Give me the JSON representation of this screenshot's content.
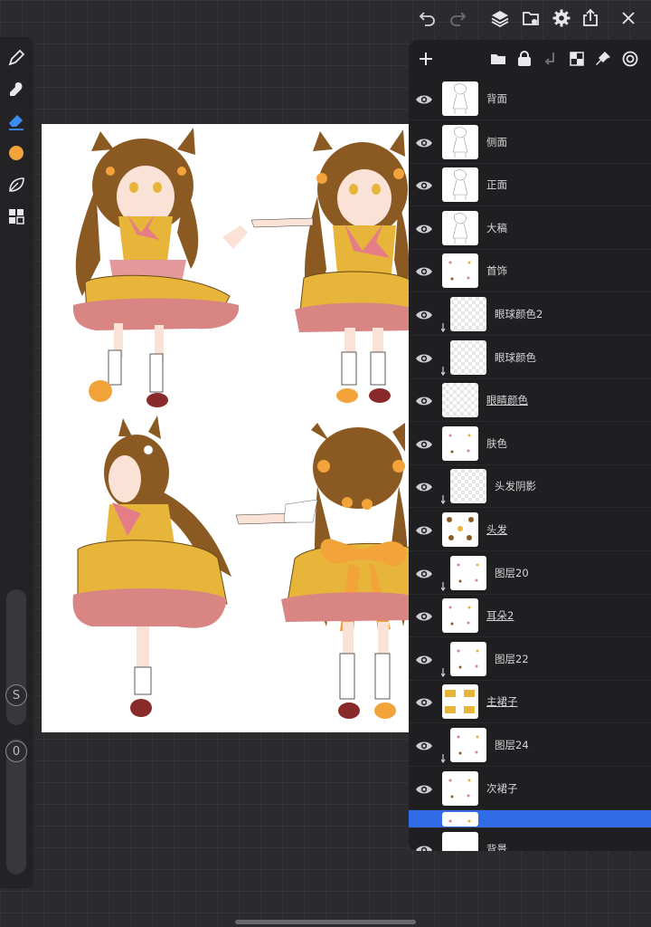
{
  "toolbar": {
    "icons": [
      "undo-icon",
      "redo-icon",
      "layers-icon",
      "gallery-icon",
      "settings-icon",
      "share-icon",
      "close-icon"
    ]
  },
  "left_tools": {
    "icons": [
      "brush-icon",
      "smudge-icon",
      "eraser-icon",
      "color-swatch",
      "leaf-icon",
      "layout-icon"
    ],
    "color": "#f2a33a",
    "size_slider_label": "S",
    "opacity_slider_label": "0"
  },
  "layers": [
    {
      "name": "背面",
      "thumb": "sketch",
      "clipped": false
    },
    {
      "name": "侧面",
      "thumb": "sketch",
      "clipped": false
    },
    {
      "name": "正面",
      "thumb": "sketch",
      "clipped": false
    },
    {
      "name": "大稿",
      "thumb": "sketch",
      "clipped": false
    },
    {
      "name": "首饰",
      "thumb": "dots",
      "clipped": false
    },
    {
      "name": "眼球颜色2",
      "thumb": "checker",
      "clipped": true
    },
    {
      "name": "眼球颜色",
      "thumb": "checker",
      "clipped": true
    },
    {
      "name": "眼睛颜色",
      "thumb": "checker",
      "clipped": false
    },
    {
      "name": "肤色",
      "thumb": "dots",
      "clipped": false
    },
    {
      "name": "头发阴影",
      "thumb": "checker",
      "clipped": true
    },
    {
      "name": "头发",
      "thumb": "hair",
      "clipped": false
    },
    {
      "name": "图层20",
      "thumb": "dots",
      "clipped": true
    },
    {
      "name": "耳朵2",
      "thumb": "dots",
      "clipped": false
    },
    {
      "name": "图层22",
      "thumb": "dots",
      "clipped": true
    },
    {
      "name": "主裙子",
      "thumb": "skirt",
      "clipped": false
    },
    {
      "name": "图层24",
      "thumb": "dots",
      "clipped": true
    },
    {
      "name": "次裙子",
      "thumb": "dots",
      "clipped": false
    },
    {
      "name": "",
      "thumb": "dots",
      "clipped": false,
      "selected": true
    },
    {
      "name": "背景",
      "thumb": "white",
      "clipped": false
    }
  ],
  "colors": {
    "accent": "#2f6ce6",
    "hair": "#8a5a22",
    "dress": "#e7b53a",
    "skirt_pink": "#d98584",
    "bow": "#e57d86"
  }
}
